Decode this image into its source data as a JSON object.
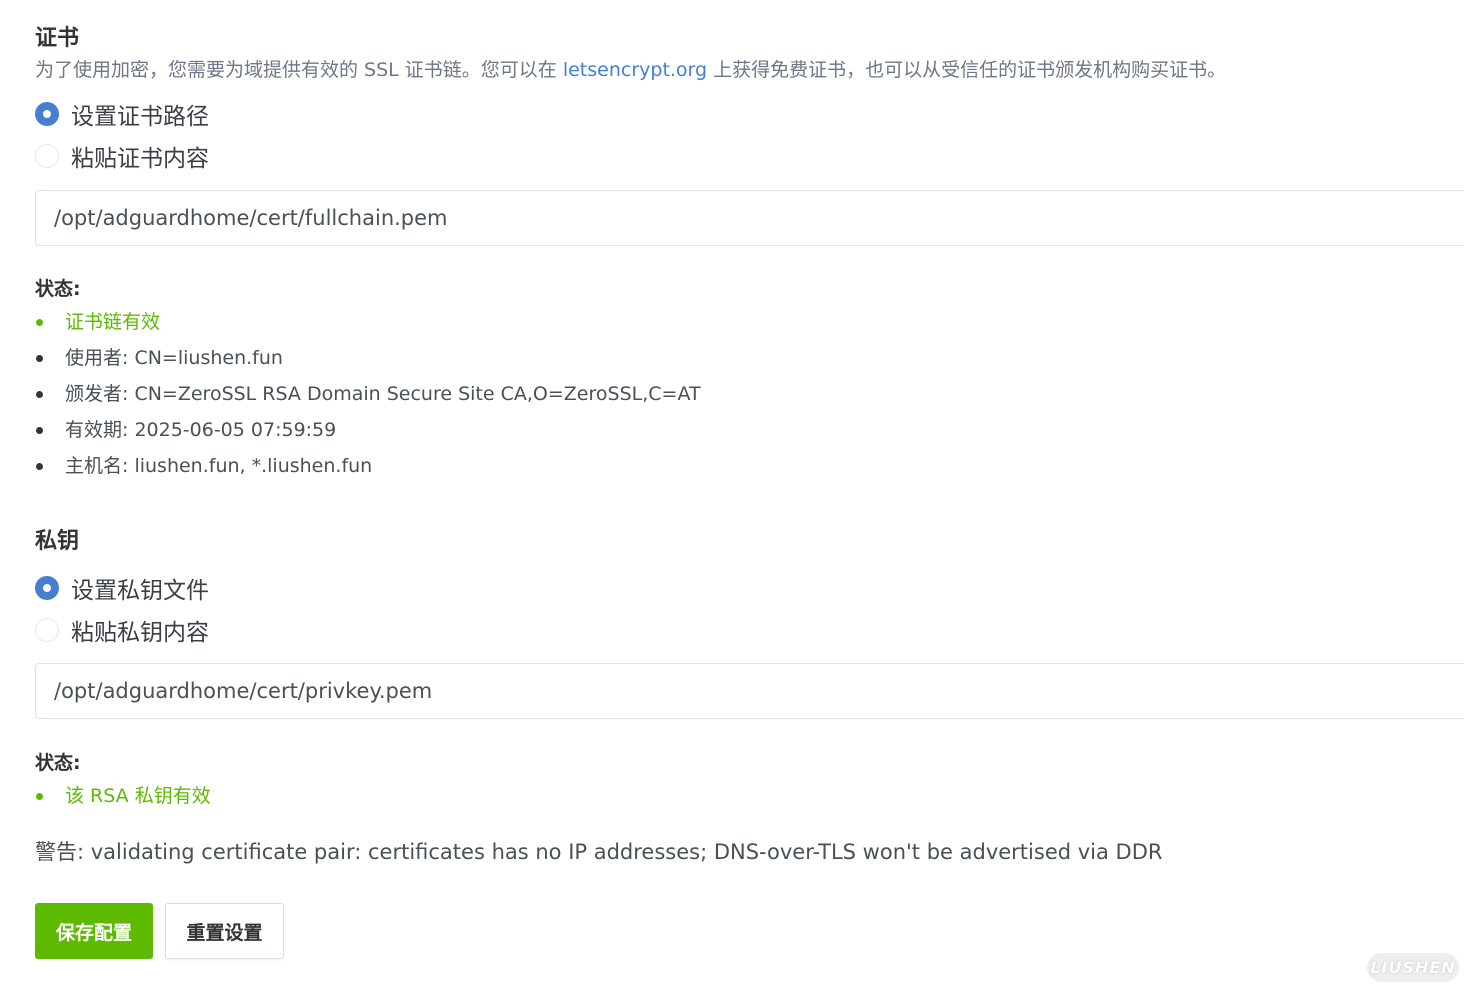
{
  "cert": {
    "title": "证书",
    "desc_before": "为了使用加密，您需要为域提供有效的 SSL 证书链。您可以在 ",
    "desc_link": "letsencrypt.org",
    "desc_after": " 上获得免费证书，也可以从受信任的证书颁发机构购买证书。",
    "radio_path_label": "设置证书路径",
    "radio_paste_label": "粘贴证书内容",
    "selected": "path",
    "path_value": "/opt/adguardhome/cert/fullchain.pem",
    "status_label": "状态:",
    "status_items": [
      "证书链有效",
      "使用者: CN=liushen.fun",
      "颁发者: CN=ZeroSSL RSA Domain Secure Site CA,O=ZeroSSL,C=AT",
      "有效期: 2025-06-05 07:59:59",
      "主机名: liushen.fun, *.liushen.fun"
    ]
  },
  "key": {
    "title": "私钥",
    "radio_file_label": "设置私钥文件",
    "radio_paste_label": "粘贴私钥内容",
    "selected": "file",
    "path_value": "/opt/adguardhome/cert/privkey.pem",
    "status_label": "状态:",
    "status_items": [
      "该 RSA 私钥有效"
    ]
  },
  "warning": "警告: validating certificate pair: certificates has no IP addresses; DNS-over-TLS won't be advertised via DDR",
  "buttons": {
    "save_label": "保存配置",
    "reset_label": "重置设置"
  },
  "watermark": "LIUSHEN",
  "colors": {
    "primary": "#467fcf",
    "success": "#5eba00",
    "text": "#495057"
  }
}
